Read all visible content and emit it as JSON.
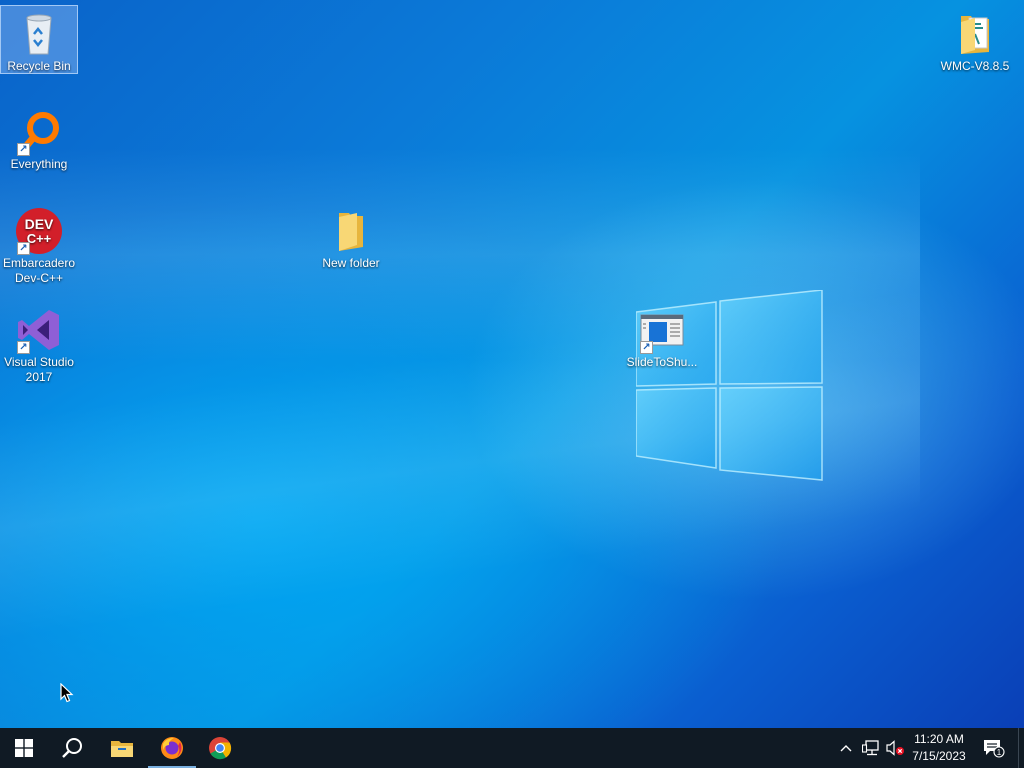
{
  "desktop": {
    "icons": [
      {
        "label": "Recycle Bin"
      },
      {
        "label": "Everything"
      },
      {
        "label": "Embarcadero Dev-C++"
      },
      {
        "label": "Visual Studio 2017"
      },
      {
        "label": "New folder"
      },
      {
        "label": "SlideToShu..."
      },
      {
        "label": "WMC-V8.8.5"
      }
    ],
    "devcpp_icon_text": [
      "DEV",
      "C++"
    ]
  },
  "taskbar": {
    "start": "start-icon",
    "search": "search-icon",
    "pinned": [
      "file-explorer-icon",
      "firefox-icon",
      "chrome-icon"
    ],
    "active_app": "firefox",
    "tray": {
      "overflow": "chevron-up-icon",
      "network": "network-icon",
      "volume": "volume-muted-icon",
      "time": "11:20 AM",
      "date": "7/15/2023",
      "notifications_count": "1"
    }
  },
  "colors": {
    "taskbar_bg": "#101a24",
    "accent": "#0a78d7"
  }
}
